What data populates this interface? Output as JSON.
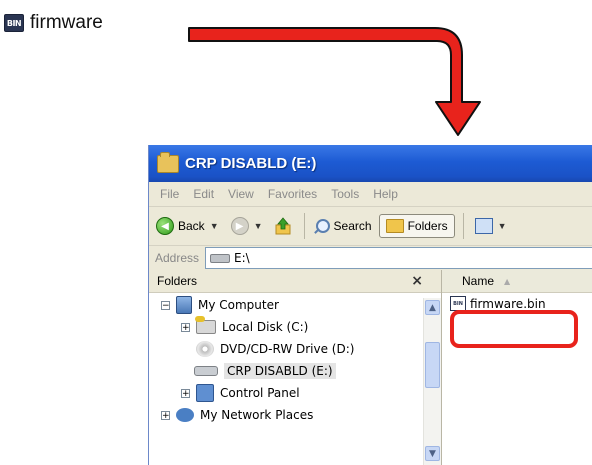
{
  "top_file": {
    "badge": "BIN",
    "label": "firmware"
  },
  "window": {
    "title": "CRP DISABLD (E:)",
    "menu": [
      "File",
      "Edit",
      "View",
      "Favorites",
      "Tools",
      "Help"
    ],
    "toolbar": {
      "back": "Back",
      "search": "Search",
      "folders": "Folders"
    },
    "address": {
      "label": "Address",
      "value": "E:\\"
    },
    "folders_pane": {
      "title": "Folders",
      "close": "×",
      "tree": [
        {
          "label": "My Computer",
          "expander": "−"
        },
        {
          "label": "Local Disk (C:)",
          "expander": "+"
        },
        {
          "label": "DVD/CD-RW Drive (D:)",
          "expander": ""
        },
        {
          "label": "CRP DISABLD (E:)",
          "expander": ""
        },
        {
          "label": "Control Panel",
          "expander": "+"
        },
        {
          "label": "My Network Places",
          "expander": "+"
        }
      ]
    },
    "files_pane": {
      "column_name": "Name",
      "files": [
        {
          "name": "firmware.bin",
          "badge": "BIN"
        }
      ]
    }
  },
  "colors": {
    "arrow": "#e8231c",
    "titlebar": "#2460d6",
    "highlight": "#e8231c"
  }
}
